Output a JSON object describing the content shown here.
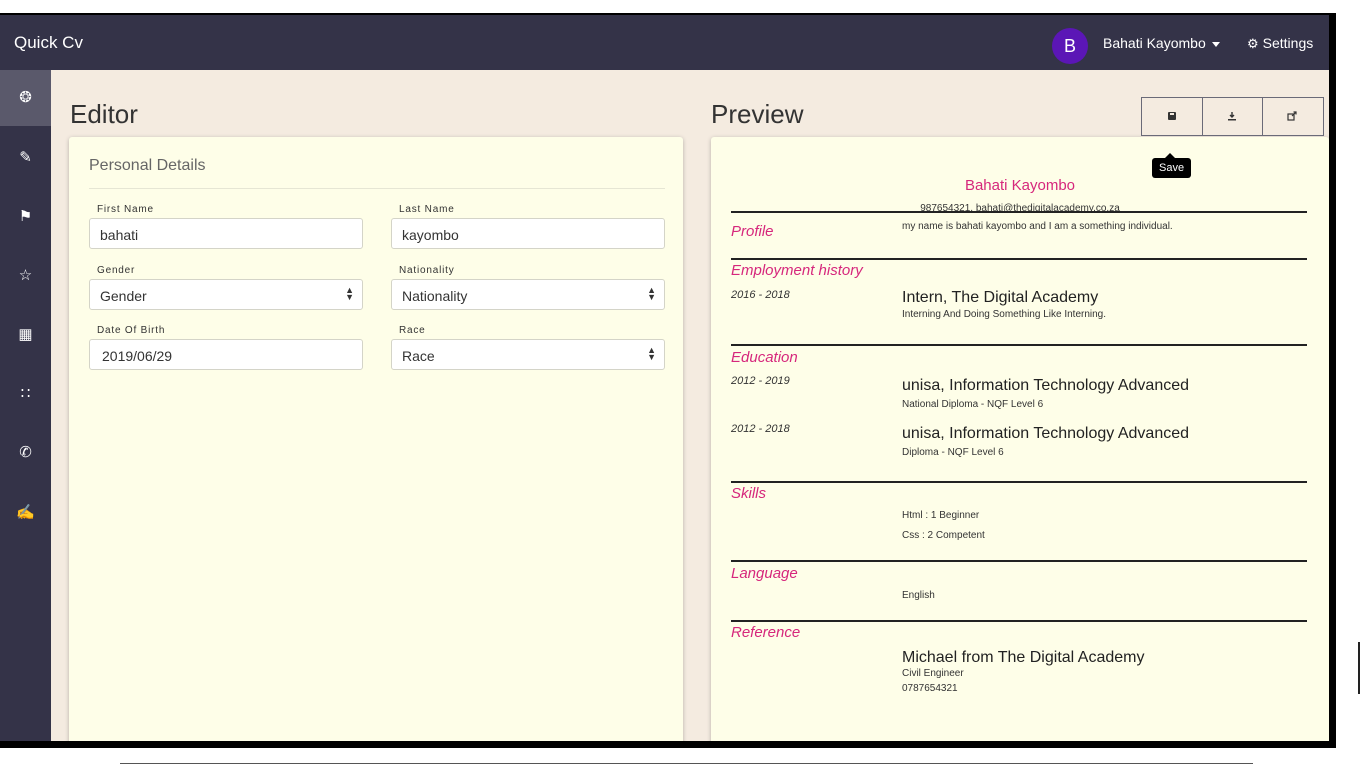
{
  "app": {
    "title": "Quick Cv"
  },
  "user": {
    "initial": "B",
    "name": "Bahati Kayombo",
    "settings_label": "Settings"
  },
  "sidebar": {
    "items": [
      {
        "icon": "user-icon",
        "glyph": "❂"
      },
      {
        "icon": "edit-icon",
        "glyph": "✎"
      },
      {
        "icon": "graduation-icon",
        "glyph": "⚑"
      },
      {
        "icon": "star-icon",
        "glyph": "☆"
      },
      {
        "icon": "building-icon",
        "glyph": "▦"
      },
      {
        "icon": "sitemap-icon",
        "glyph": "∷"
      },
      {
        "icon": "comments-icon",
        "glyph": "✆"
      },
      {
        "icon": "user-edit-icon",
        "glyph": "✍"
      }
    ]
  },
  "editor": {
    "heading": "Editor",
    "section_title": "Personal Details",
    "fields": {
      "first_name": {
        "label": "First Name",
        "value": "bahati"
      },
      "last_name": {
        "label": "Last Name",
        "value": "kayombo"
      },
      "gender": {
        "label": "Gender",
        "value": "Gender"
      },
      "nationality": {
        "label": "Nationality",
        "value": "Nationality"
      },
      "dob": {
        "label": "Date Of Birth",
        "value": "2019/06/29"
      },
      "race": {
        "label": "Race",
        "value": "Race"
      }
    }
  },
  "preview": {
    "heading": "Preview",
    "toolbar": {
      "save_icon": "save-icon",
      "download_icon": "download-icon",
      "share_icon": "share-icon",
      "tooltip": "Save"
    },
    "cv": {
      "name": "Bahati Kayombo",
      "contact": "987654321, bahati@thedigitalacademy.co.za",
      "profile_title": "Profile",
      "profile_text": "my name is bahati kayombo and I am a something individual.",
      "employment_title": "Employment history",
      "employment": [
        {
          "dates": "2016 - 2018",
          "title": "Intern, The Digital Academy",
          "description": "Interning And Doing Something Like Interning."
        }
      ],
      "education_title": "Education",
      "education": [
        {
          "dates": "2012 - 2019",
          "title": "unisa, Information Technology Advanced",
          "description": "National Diploma - NQF Level 6"
        },
        {
          "dates": "2012 - 2018",
          "title": "unisa, Information Technology Advanced",
          "description": "Diploma - NQF Level 6"
        }
      ],
      "skills_title": "Skills",
      "skills": [
        "Html : 1 Beginner",
        "Css : 2 Competent"
      ],
      "language_title": "Language",
      "languages": [
        "English"
      ],
      "reference_title": "Reference",
      "reference": {
        "name": "Michael from The Digital Academy",
        "role": "Civil Engineer",
        "phone": "0787654321"
      }
    }
  },
  "colors": {
    "topbar": "#343348",
    "accent": "#d6277c",
    "avatar": "#5b16b6",
    "panel": "#fefee8",
    "background": "#f4ebe0"
  }
}
